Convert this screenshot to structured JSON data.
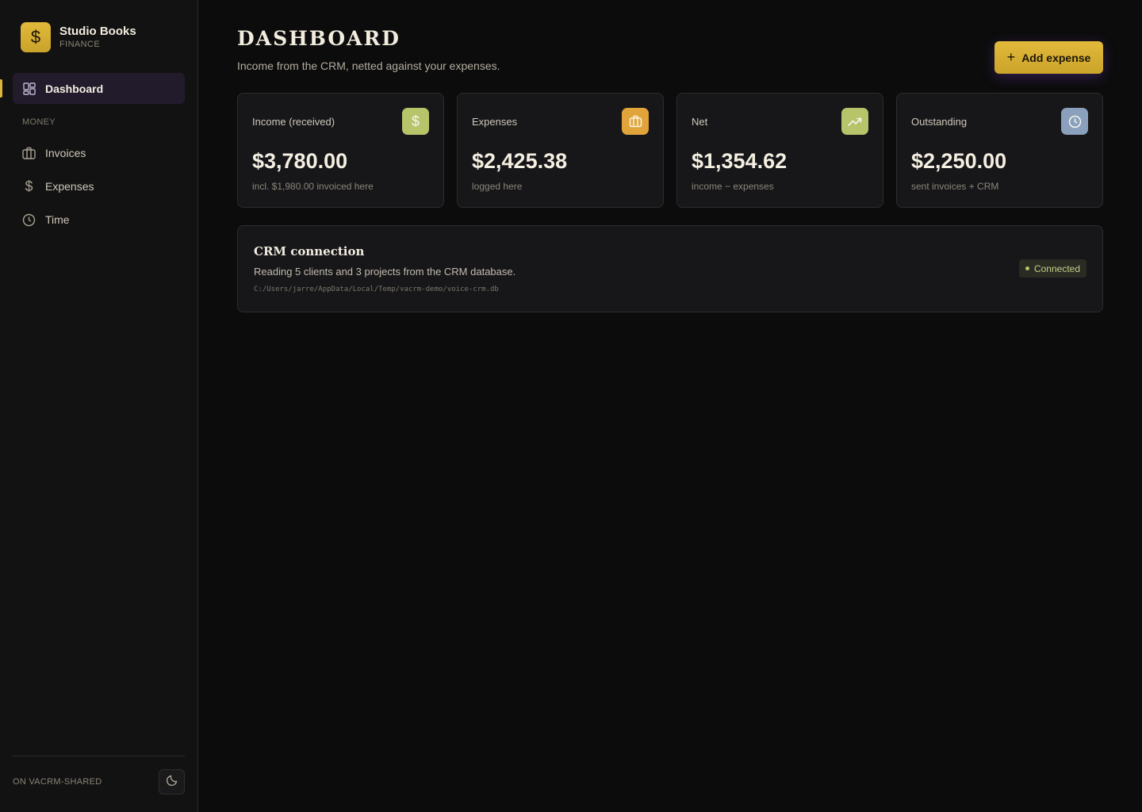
{
  "app": {
    "name": "Studio Books",
    "subtitle": "FINANCE",
    "logo_icon": "dollar-icon"
  },
  "sidebar": {
    "active_item": {
      "label": "Dashboard",
      "icon": "grid-icon"
    },
    "section_label": "MONEY",
    "items": [
      {
        "label": "Invoices",
        "icon": "briefcase-icon"
      },
      {
        "label": "Expenses",
        "icon": "dollar-icon"
      },
      {
        "label": "Time",
        "icon": "clock-icon"
      }
    ],
    "footer_label": "ON VACRM-SHARED",
    "theme_toggle_icon": "moon-icon"
  },
  "header": {
    "title": "DASHBOARD",
    "subtitle": "Income from the CRM, netted against your expenses.",
    "add_button_label": "Add expense"
  },
  "stats": [
    {
      "label": "Income (received)",
      "value": "$3,780.00",
      "note": "incl. $1,980.00 invoiced here",
      "icon": "dollar-icon",
      "color": "#b8c46a"
    },
    {
      "label": "Expenses",
      "value": "$2,425.38",
      "note": "logged here",
      "icon": "briefcase-icon",
      "color": "#e0a43a"
    },
    {
      "label": "Net",
      "value": "$1,354.62",
      "note": "income − expenses",
      "icon": "trending-up-icon",
      "color": "#b8c46a"
    },
    {
      "label": "Outstanding",
      "value": "$2,250.00",
      "note": "sent invoices + CRM",
      "icon": "clock-icon",
      "color": "#8aa0bc"
    }
  ],
  "crm": {
    "title": "CRM connection",
    "description": "Reading 5 clients and 3 projects from the CRM database.",
    "path": "C:/Users/jarre/AppData/Local/Temp/vacrm-demo/voice-crm.db",
    "status": "Connected"
  },
  "colors": {
    "accent": "#e0b43a",
    "background": "#0c0c0c",
    "sidebar": "#121212",
    "active_nav": "#221b2c"
  }
}
